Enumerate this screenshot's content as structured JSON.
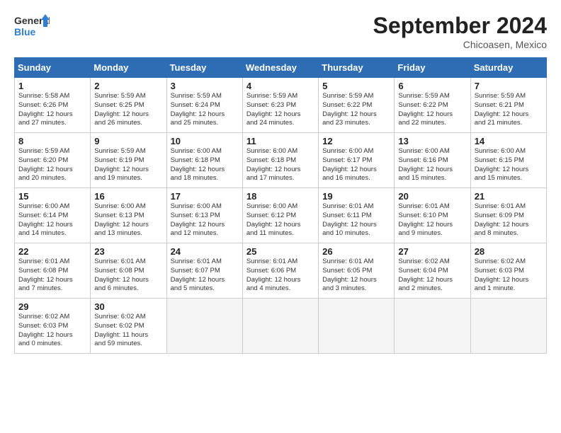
{
  "header": {
    "logo_line1": "General",
    "logo_line2": "Blue",
    "title": "September 2024",
    "location": "Chicoasen, Mexico"
  },
  "weekdays": [
    "Sunday",
    "Monday",
    "Tuesday",
    "Wednesday",
    "Thursday",
    "Friday",
    "Saturday"
  ],
  "weeks": [
    [
      {
        "day": "1",
        "info": "Sunrise: 5:58 AM\nSunset: 6:26 PM\nDaylight: 12 hours\nand 27 minutes."
      },
      {
        "day": "2",
        "info": "Sunrise: 5:59 AM\nSunset: 6:25 PM\nDaylight: 12 hours\nand 26 minutes."
      },
      {
        "day": "3",
        "info": "Sunrise: 5:59 AM\nSunset: 6:24 PM\nDaylight: 12 hours\nand 25 minutes."
      },
      {
        "day": "4",
        "info": "Sunrise: 5:59 AM\nSunset: 6:23 PM\nDaylight: 12 hours\nand 24 minutes."
      },
      {
        "day": "5",
        "info": "Sunrise: 5:59 AM\nSunset: 6:22 PM\nDaylight: 12 hours\nand 23 minutes."
      },
      {
        "day": "6",
        "info": "Sunrise: 5:59 AM\nSunset: 6:22 PM\nDaylight: 12 hours\nand 22 minutes."
      },
      {
        "day": "7",
        "info": "Sunrise: 5:59 AM\nSunset: 6:21 PM\nDaylight: 12 hours\nand 21 minutes."
      }
    ],
    [
      {
        "day": "8",
        "info": "Sunrise: 5:59 AM\nSunset: 6:20 PM\nDaylight: 12 hours\nand 20 minutes."
      },
      {
        "day": "9",
        "info": "Sunrise: 5:59 AM\nSunset: 6:19 PM\nDaylight: 12 hours\nand 19 minutes."
      },
      {
        "day": "10",
        "info": "Sunrise: 6:00 AM\nSunset: 6:18 PM\nDaylight: 12 hours\nand 18 minutes."
      },
      {
        "day": "11",
        "info": "Sunrise: 6:00 AM\nSunset: 6:18 PM\nDaylight: 12 hours\nand 17 minutes."
      },
      {
        "day": "12",
        "info": "Sunrise: 6:00 AM\nSunset: 6:17 PM\nDaylight: 12 hours\nand 16 minutes."
      },
      {
        "day": "13",
        "info": "Sunrise: 6:00 AM\nSunset: 6:16 PM\nDaylight: 12 hours\nand 15 minutes."
      },
      {
        "day": "14",
        "info": "Sunrise: 6:00 AM\nSunset: 6:15 PM\nDaylight: 12 hours\nand 15 minutes."
      }
    ],
    [
      {
        "day": "15",
        "info": "Sunrise: 6:00 AM\nSunset: 6:14 PM\nDaylight: 12 hours\nand 14 minutes."
      },
      {
        "day": "16",
        "info": "Sunrise: 6:00 AM\nSunset: 6:13 PM\nDaylight: 12 hours\nand 13 minutes."
      },
      {
        "day": "17",
        "info": "Sunrise: 6:00 AM\nSunset: 6:13 PM\nDaylight: 12 hours\nand 12 minutes."
      },
      {
        "day": "18",
        "info": "Sunrise: 6:00 AM\nSunset: 6:12 PM\nDaylight: 12 hours\nand 11 minutes."
      },
      {
        "day": "19",
        "info": "Sunrise: 6:01 AM\nSunset: 6:11 PM\nDaylight: 12 hours\nand 10 minutes."
      },
      {
        "day": "20",
        "info": "Sunrise: 6:01 AM\nSunset: 6:10 PM\nDaylight: 12 hours\nand 9 minutes."
      },
      {
        "day": "21",
        "info": "Sunrise: 6:01 AM\nSunset: 6:09 PM\nDaylight: 12 hours\nand 8 minutes."
      }
    ],
    [
      {
        "day": "22",
        "info": "Sunrise: 6:01 AM\nSunset: 6:08 PM\nDaylight: 12 hours\nand 7 minutes."
      },
      {
        "day": "23",
        "info": "Sunrise: 6:01 AM\nSunset: 6:08 PM\nDaylight: 12 hours\nand 6 minutes."
      },
      {
        "day": "24",
        "info": "Sunrise: 6:01 AM\nSunset: 6:07 PM\nDaylight: 12 hours\nand 5 minutes."
      },
      {
        "day": "25",
        "info": "Sunrise: 6:01 AM\nSunset: 6:06 PM\nDaylight: 12 hours\nand 4 minutes."
      },
      {
        "day": "26",
        "info": "Sunrise: 6:01 AM\nSunset: 6:05 PM\nDaylight: 12 hours\nand 3 minutes."
      },
      {
        "day": "27",
        "info": "Sunrise: 6:02 AM\nSunset: 6:04 PM\nDaylight: 12 hours\nand 2 minutes."
      },
      {
        "day": "28",
        "info": "Sunrise: 6:02 AM\nSunset: 6:03 PM\nDaylight: 12 hours\nand 1 minute."
      }
    ],
    [
      {
        "day": "29",
        "info": "Sunrise: 6:02 AM\nSunset: 6:03 PM\nDaylight: 12 hours\nand 0 minutes."
      },
      {
        "day": "30",
        "info": "Sunrise: 6:02 AM\nSunset: 6:02 PM\nDaylight: 11 hours\nand 59 minutes."
      },
      {
        "day": "",
        "info": ""
      },
      {
        "day": "",
        "info": ""
      },
      {
        "day": "",
        "info": ""
      },
      {
        "day": "",
        "info": ""
      },
      {
        "day": "",
        "info": ""
      }
    ]
  ]
}
